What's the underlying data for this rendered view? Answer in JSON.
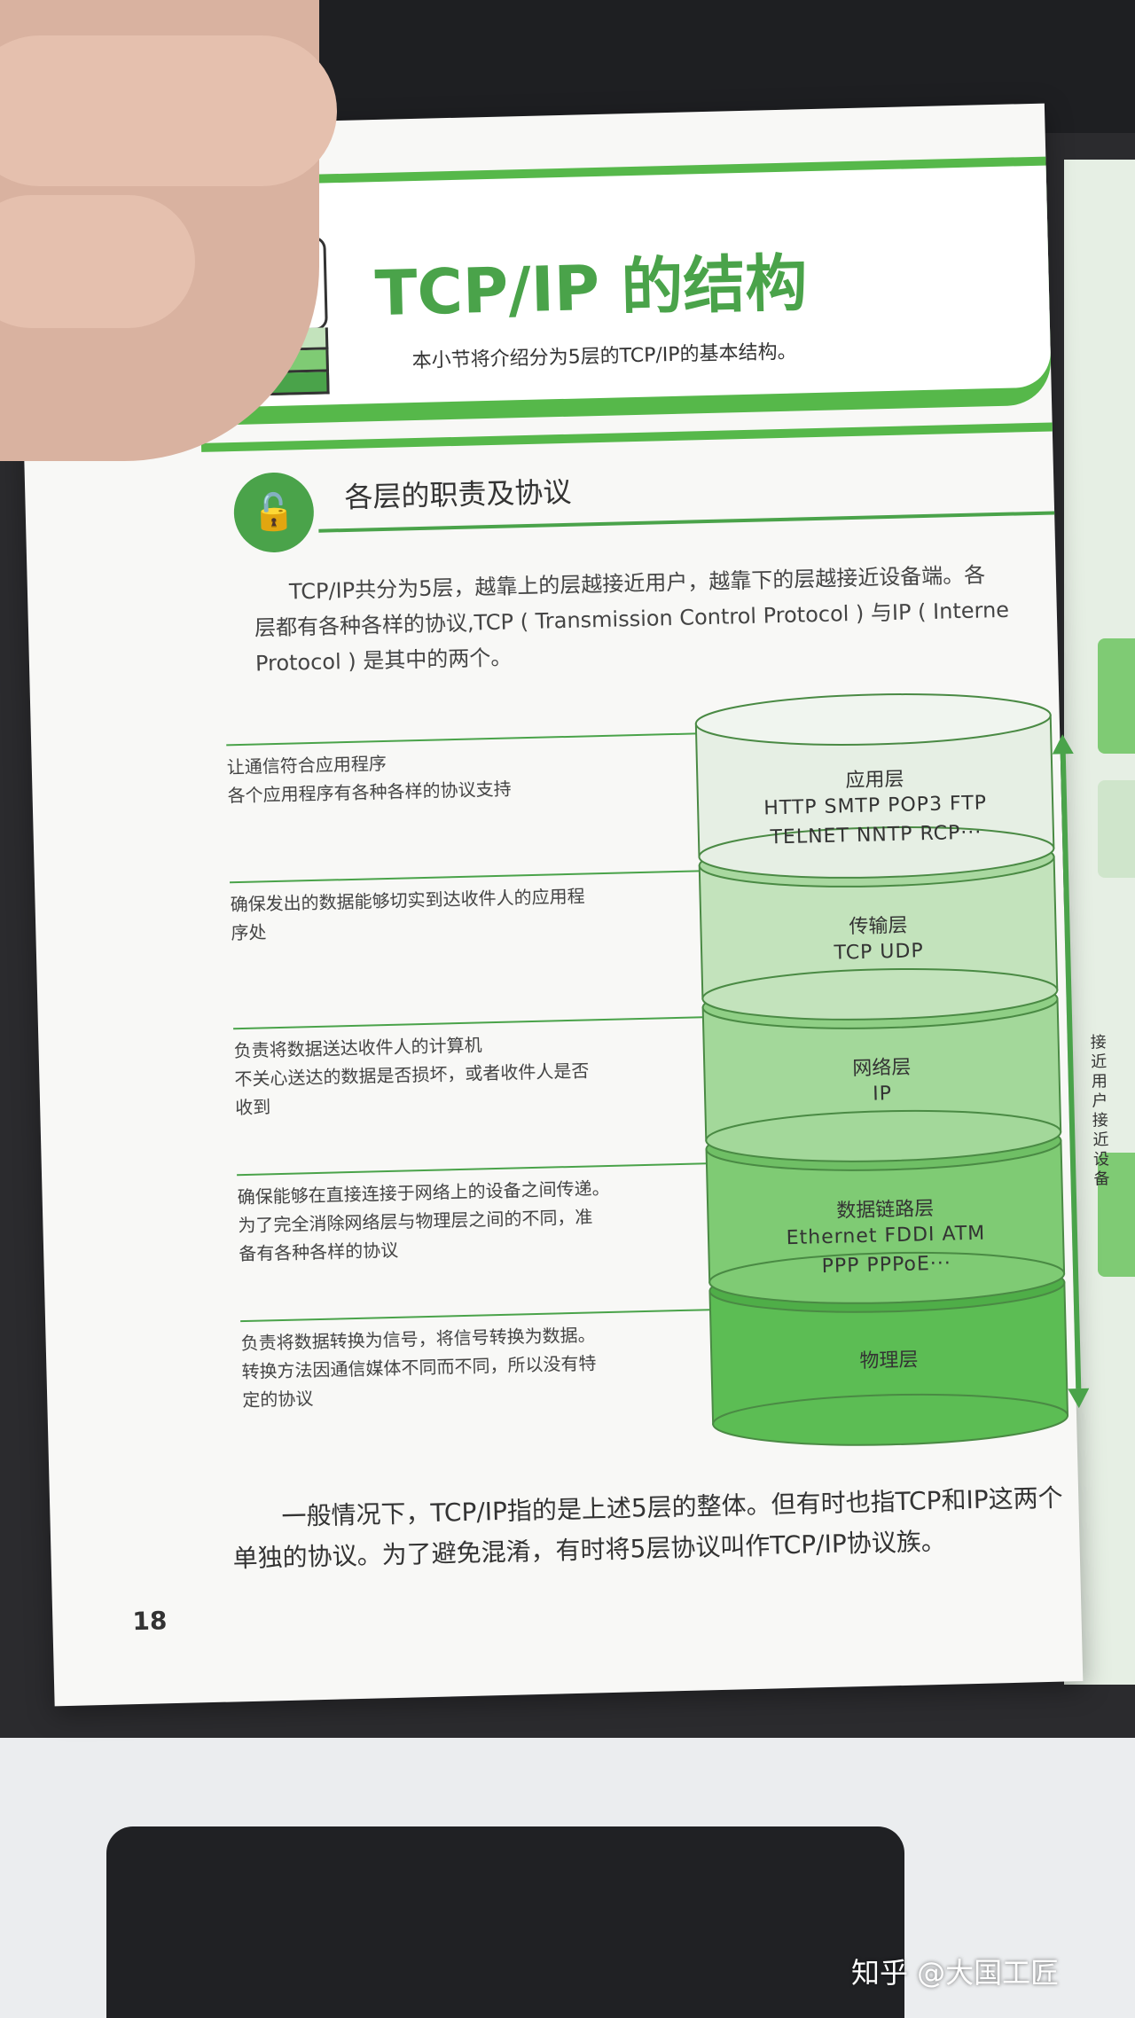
{
  "header": {
    "title": "TCP/IP 的结构",
    "subtitle": "本小节将介绍分为5层的TCP/IP的基本结构。"
  },
  "section": {
    "title": "各层的职责及协议",
    "icon": "lock-icon"
  },
  "intro_lines": [
    "TCP/IP共分为5层，越靠上的层越接近用户，越靠下的层越接近设备端。各",
    "层都有各种各样的协议,TCP ( Transmission Control Protocol ) 与IP ( Interne",
    "Protocol ) 是其中的两个。"
  ],
  "layers": [
    {
      "name": "应用层",
      "protocols": [
        "HTTP   SMTP   POP3   FTP",
        "TELNET   NNTP   RCP···"
      ],
      "description": [
        "让通信符合应用程序",
        "各个应用程序有各种各样的协议支持"
      ]
    },
    {
      "name": "传输层",
      "protocols": [
        "TCP   UDP"
      ],
      "description": [
        "确保发出的数据能够切实到达收件人的应用程",
        "序处"
      ]
    },
    {
      "name": "网络层",
      "protocols": [
        "IP"
      ],
      "description": [
        "负责将数据送达收件人的计算机",
        "不关心送达的数据是否损坏，或者收件人是否",
        "收到"
      ]
    },
    {
      "name": "数据链路层",
      "protocols": [
        "Ethernet   FDDI   ATM",
        "PPP   PPPoE···"
      ],
      "description": [
        "确保能够在直接连接于网络上的设备之间传递。",
        "为了完全消除网络层与物理层之间的不同，准",
        "备有各种各样的协议"
      ]
    },
    {
      "name": "物理层",
      "protocols": [],
      "description": [
        "负责将数据转换为信号，将信号转换为数据。",
        "转换方法因通信媒体不同而不同，所以没有特",
        "定的协议"
      ]
    }
  ],
  "side_arrow_label": "接近用户接近设备",
  "bottom_lines": [
    "一般情况下，TCP/IP指的是上述5层的整体。但有时也指TCP和IP这两个",
    "单独的协议。为了避免混淆，有时将5层协议叫作TCP/IP协议族。"
  ],
  "page_number": "18",
  "watermark": "知乎 @大国工匠",
  "colors": {
    "accent": "#4aa34a",
    "layer_fills": [
      "#e6efe4",
      "#c3e3bc",
      "#a3d89a",
      "#7fcb74",
      "#5cbd54"
    ]
  }
}
